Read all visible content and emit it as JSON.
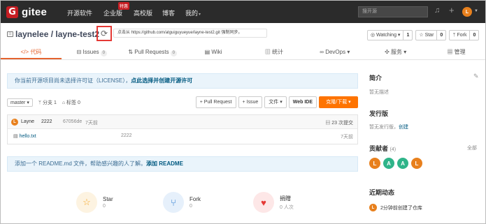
{
  "nav": {
    "logo_letter": "G",
    "logo_text": "gitee",
    "items": [
      "开源软件",
      "企业版",
      "高校版",
      "博客",
      "我的"
    ],
    "hot_badge": "特惠",
    "my_caret": "▾",
    "search_placeholder": "搜开源",
    "bell_icon": "bell-icon",
    "plus_icon": "plus-icon",
    "avatar_letter": "L"
  },
  "repo": {
    "owner": "laynelee",
    "separator": " / ",
    "name": "layne-test2",
    "sync_icon": "sync-icon",
    "sync_tip": "点击从 https://github.com/atguiguyueyue/layne-test2.git 强制同步。",
    "watching_label": "◎ Watching ▾",
    "watching_count": "1",
    "star_label": "☆ Star",
    "star_count": "0",
    "fork_label": "ᛘ Fork",
    "fork_count": "0"
  },
  "tabs": [
    {
      "label": "</> 代码",
      "badge": ""
    },
    {
      "label": "Issues",
      "badge": "0"
    },
    {
      "label": "Pull Requests",
      "badge": "0"
    },
    {
      "label": "Wiki",
      "badge": ""
    },
    {
      "label": "统计",
      "badge": ""
    },
    {
      "label": "DevOps ▾",
      "badge": ""
    },
    {
      "label": "服务 ▾",
      "badge": ""
    },
    {
      "label": "管理",
      "badge": ""
    }
  ],
  "license_notice": {
    "text": "你当前开源项目尚未选择许可证（LICENSE），",
    "link": "点此选择并创建开源许可"
  },
  "toolbar": {
    "branch": "master ▾",
    "branches": "分支 1",
    "tags": "标签 0",
    "pull_request": "+ Pull Request",
    "issue": "+ Issue",
    "file": "文件 ▾",
    "webide": "Web IDE",
    "download": "克隆/下载 ▾"
  },
  "commit": {
    "avatar_letter": "L",
    "user": "Layne",
    "message": "2222",
    "hash": "67056de",
    "time": "7天前",
    "count": "23 次提交"
  },
  "files": [
    {
      "name": "hello.txt",
      "message": "2222",
      "time": "7天前"
    }
  ],
  "readme_notice": {
    "text": "添加一个 README.md 文件，帮助感兴趣的人了解。",
    "link": "添加 README"
  },
  "stats": [
    {
      "label": "Star",
      "value": "0",
      "icon": "star-icon",
      "color": "#f5a623",
      "bg": "#fdf3e1"
    },
    {
      "label": "Fork",
      "value": "0",
      "icon": "fork-icon",
      "color": "#2b7bd1",
      "bg": "#e6f0fb"
    },
    {
      "label": "捐赠",
      "value": "0 人次",
      "icon": "donate-icon",
      "color": "#e53935",
      "bg": "#fde7e7"
    }
  ],
  "sidebar": {
    "intro_title": "简介",
    "intro_text": "暂无描述",
    "release_title": "发行版",
    "release_text": "暂无发行版，",
    "release_link": "创建",
    "contrib_title": "贡献者",
    "contrib_count": "(4)",
    "all_link": "全部",
    "contributors": [
      {
        "letter": "L",
        "color": "#e8801d"
      },
      {
        "letter": "A",
        "color": "#2fb489"
      },
      {
        "letter": "A",
        "color": "#2fb489"
      },
      {
        "letter": "L",
        "color": "#e8801d"
      }
    ],
    "activity_title": "近期动态",
    "activity_text": "2分钟前创建了仓库",
    "activity_avatar": "L"
  },
  "colors": {
    "brand": "#c71d23",
    "accent": "#fe7300",
    "link": "#005980"
  }
}
